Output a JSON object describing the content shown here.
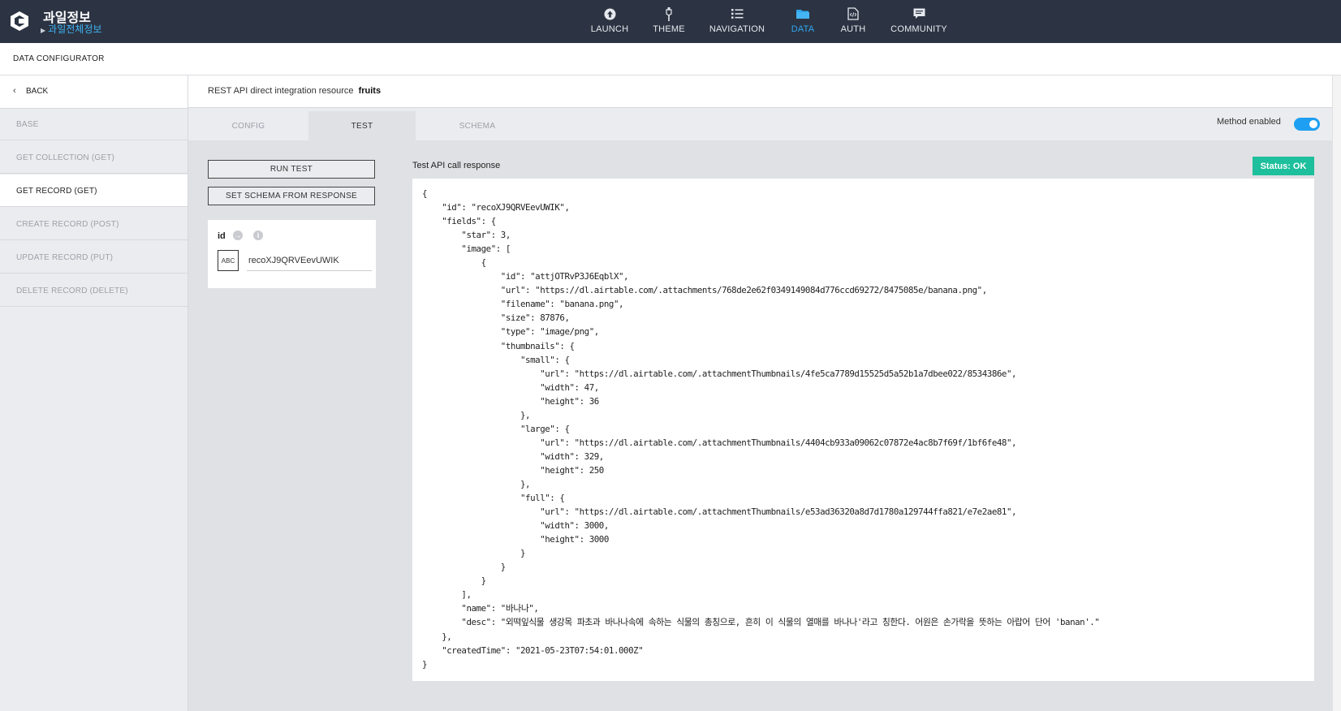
{
  "app": {
    "title": "과일정보",
    "subtitle": "과일전체정보"
  },
  "nav": [
    {
      "label": "LAUNCH",
      "icon": "launch-icon"
    },
    {
      "label": "THEME",
      "icon": "theme-brush-icon"
    },
    {
      "label": "NAVIGATION",
      "icon": "navigation-list-icon"
    },
    {
      "label": "DATA",
      "icon": "folder-icon",
      "active": true
    },
    {
      "label": "AUTH",
      "icon": "auth-code-icon"
    },
    {
      "label": "COMMUNITY",
      "icon": "chat-icon"
    }
  ],
  "header": {
    "title": "DATA CONFIGURATOR"
  },
  "sidebar": {
    "back_label": "BACK",
    "items": [
      {
        "label": "BASE"
      },
      {
        "label": "GET COLLECTION (GET)"
      },
      {
        "label": "GET RECORD (GET)",
        "active": true
      },
      {
        "label": "CREATE RECORD (POST)"
      },
      {
        "label": "UPDATE RECORD (PUT)"
      },
      {
        "label": "DELETE RECORD (DELETE)"
      }
    ]
  },
  "resource": {
    "label": "REST API direct integration resource",
    "name": "fruits"
  },
  "tabs": [
    {
      "label": "CONFIG"
    },
    {
      "label": "TEST",
      "active": true
    },
    {
      "label": "SCHEMA"
    }
  ],
  "method_enabled": {
    "label": "Method enabled",
    "on": true
  },
  "test": {
    "run_label": "RUN TEST",
    "schema_label": "SET SCHEMA FROM RESPONSE",
    "param_name": "id",
    "param_type": "ABC",
    "param_value": "recoXJ9QRVEevUWIK",
    "response_title": "Test API call response",
    "status": "Status: OK",
    "response_json": "{\n    \"id\": \"recoXJ9QRVEevUWIK\",\n    \"fields\": {\n        \"star\": 3,\n        \"image\": [\n            {\n                \"id\": \"attjOTRvP3J6EqblX\",\n                \"url\": \"https://dl.airtable.com/.attachments/768de2e62f0349149084d776ccd69272/8475085e/banana.png\",\n                \"filename\": \"banana.png\",\n                \"size\": 87876,\n                \"type\": \"image/png\",\n                \"thumbnails\": {\n                    \"small\": {\n                        \"url\": \"https://dl.airtable.com/.attachmentThumbnails/4fe5ca7789d15525d5a52b1a7dbee022/8534386e\",\n                        \"width\": 47,\n                        \"height\": 36\n                    },\n                    \"large\": {\n                        \"url\": \"https://dl.airtable.com/.attachmentThumbnails/4404cb933a09062c07872e4ac8b7f69f/1bf6fe48\",\n                        \"width\": 329,\n                        \"height\": 250\n                    },\n                    \"full\": {\n                        \"url\": \"https://dl.airtable.com/.attachmentThumbnails/e53ad36320a8d7d1780a129744ffa821/e7e2ae81\",\n                        \"width\": 3000,\n                        \"height\": 3000\n                    }\n                }\n            }\n        ],\n        \"name\": \"바나나\",\n        \"desc\": \"외떡잎식물 생강목 파초과 바나나속에 속하는 식물의 총칭으로, 흔히 이 식물의 열매를 바나나'라고 칭한다. 어원은 손가락을 뜻하는 아랍어 단어 'banan'.\"\n    },\n    \"createdTime\": \"2021-05-23T07:54:01.000Z\"\n}"
  },
  "colors": {
    "topbar": "#2c3443",
    "accent": "#2fa8f0",
    "status_ok": "#1dbf9c"
  }
}
